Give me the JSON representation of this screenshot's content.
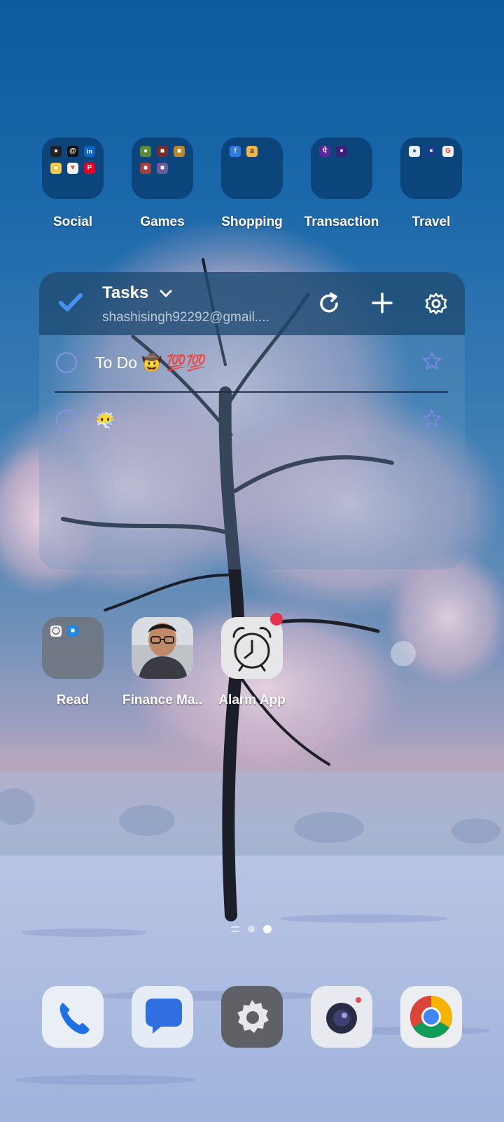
{
  "folders": [
    {
      "label": "Social"
    },
    {
      "label": "Games"
    },
    {
      "label": "Shopping"
    },
    {
      "label": "Transaction"
    },
    {
      "label": "Travel"
    }
  ],
  "tasks_widget": {
    "title": "Tasks",
    "account": "shashisingh92292@gmail....",
    "tasks": [
      {
        "text": "To Do 🤠 💯💯"
      },
      {
        "text": "😶‍🌫️"
      }
    ]
  },
  "apps_row": [
    {
      "label": "Read"
    },
    {
      "label": "Finance Ma.."
    },
    {
      "label": "Alarm App"
    }
  ],
  "page_indicator": {
    "pages": 2,
    "current": 2
  },
  "dock": [
    {
      "name": "Phone"
    },
    {
      "name": "Messages"
    },
    {
      "name": "Settings"
    },
    {
      "name": "Camera"
    },
    {
      "name": "Chrome"
    }
  ],
  "colors": {
    "folder_bg": "#0a3c6e",
    "task_check": "#8b93e4",
    "badge": "#e6314e"
  }
}
